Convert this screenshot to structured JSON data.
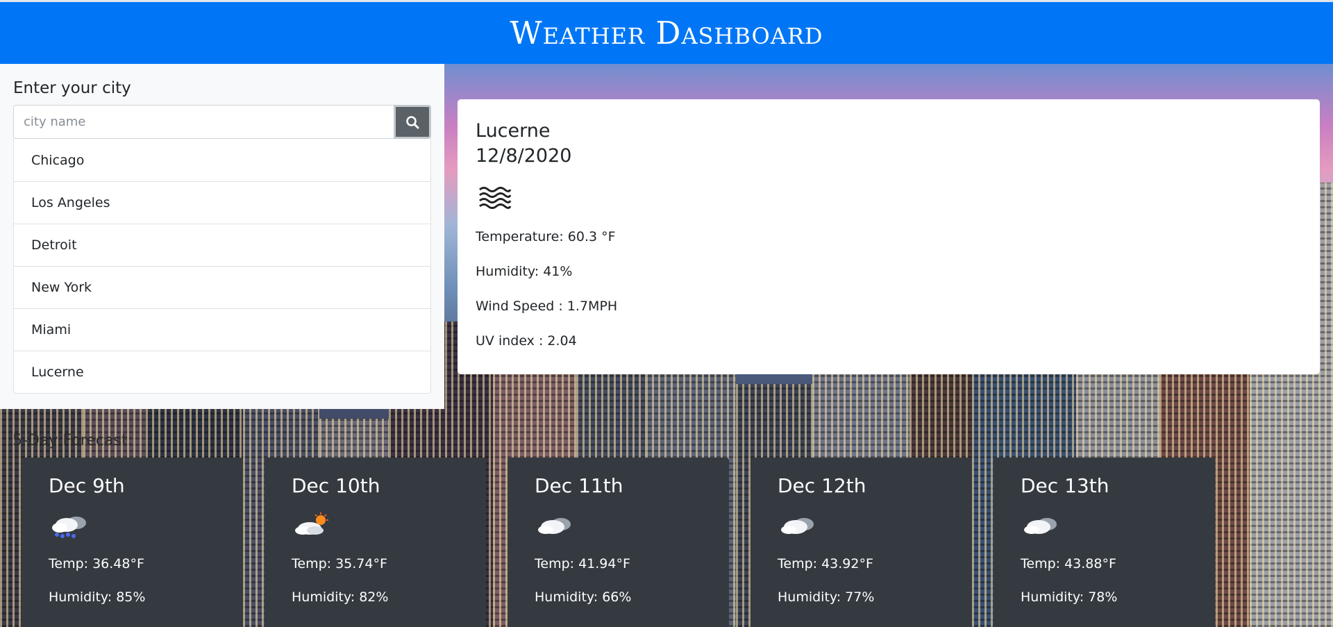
{
  "header": {
    "title": "Weather Dashboard"
  },
  "sidebar": {
    "title": "Enter your city",
    "search_placeholder": "city name",
    "search_value": "",
    "cities": [
      "Chicago",
      "Los Angeles",
      "Detroit",
      "New York",
      "Miami",
      "Lucerne"
    ]
  },
  "current": {
    "city": "Lucerne",
    "date": "12/8/2020",
    "icon": "mist-icon",
    "temperature": "Temperature: 60.3 °F",
    "humidity": "Humidity: 41%",
    "wind": "Wind Speed : 1.7MPH",
    "uv": "UV index : 2.04"
  },
  "forecast": {
    "label": "5-Day Forecast:",
    "days": [
      {
        "date": "Dec 9th",
        "icon": "snow-cloud-icon",
        "temp": "Temp: 36.48°F",
        "humidity": "Humidity: 85%"
      },
      {
        "date": "Dec 10th",
        "icon": "sun-cloud-icon",
        "temp": "Temp: 35.74°F",
        "humidity": "Humidity: 82%"
      },
      {
        "date": "Dec 11th",
        "icon": "cloud-icon",
        "temp": "Temp: 41.94°F",
        "humidity": "Humidity: 66%"
      },
      {
        "date": "Dec 12th",
        "icon": "cloud-icon",
        "temp": "Temp: 43.92°F",
        "humidity": "Humidity: 77%"
      },
      {
        "date": "Dec 13th",
        "icon": "cloud-icon",
        "temp": "Temp: 43.88°F",
        "humidity": "Humidity: 78%"
      }
    ]
  },
  "colors": {
    "header": "#0076f6",
    "card_dark": "#343a40",
    "search_button": "#5a6268"
  }
}
